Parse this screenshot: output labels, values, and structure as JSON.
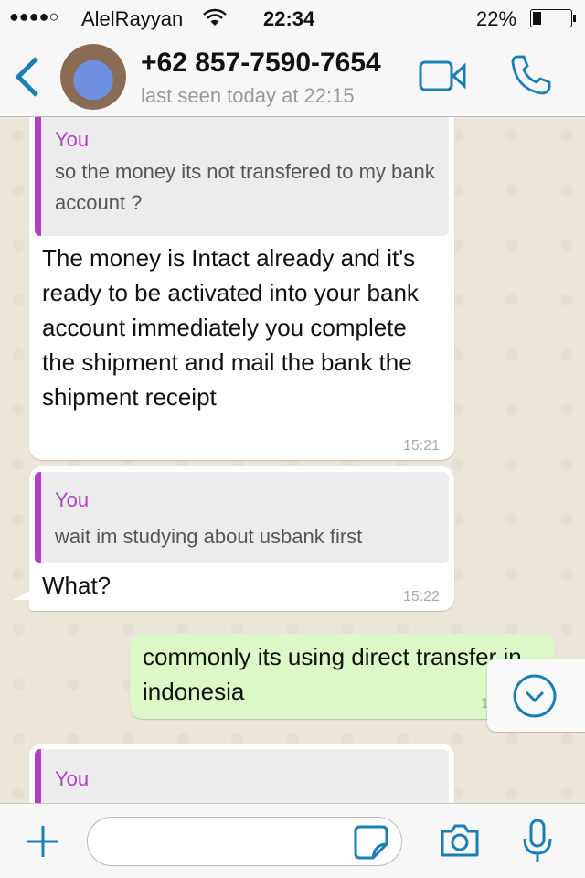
{
  "status_bar": {
    "signal": "●●●●○",
    "carrier": "AlelRayyan",
    "time": "22:34",
    "battery": "22%",
    "battery_level": 0.22
  },
  "header": {
    "contact": "+62 857-7590-7654",
    "last_seen": "last seen today at 22:15",
    "accent": "#1a7fb5"
  },
  "messages": [
    {
      "quote_name": "You",
      "quote_text": "so the money its not transfered to my bank account ?",
      "text": "The money is Intact already and it's ready to be activated into your bank account immediately you complete the shipment and mail the bank the shipment receipt",
      "time": "15:21"
    },
    {
      "quote_name": "You",
      "quote_text": "wait im studying about usbank first",
      "text": "What?",
      "time": "15:22"
    },
    {
      "text": "commonly its using direct transfer in indonesia",
      "time": "1"
    },
    {
      "quote_name": "You"
    }
  ],
  "input": {
    "placeholder": ""
  }
}
